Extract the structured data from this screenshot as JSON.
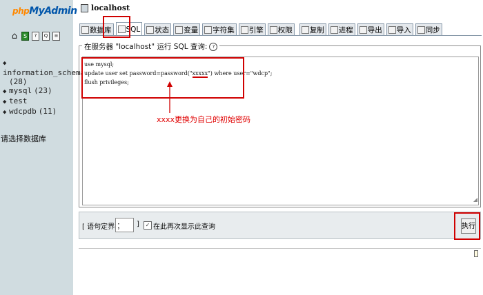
{
  "nav": {
    "logo_part1": "php",
    "logo_part2": "MyAdmin",
    "icons": [
      "home-icon",
      "sql-window-icon",
      "docs-icon",
      "query-window-icon",
      "settings-icon"
    ],
    "databases": [
      {
        "name": "information_schema",
        "count": "(28)"
      },
      {
        "name": "mysql",
        "count": "(23)"
      },
      {
        "name": "test",
        "count": ""
      },
      {
        "name": "wdcpdb",
        "count": "(11)"
      }
    ],
    "choose_db": "请选择数据库"
  },
  "header": {
    "server": "localhost"
  },
  "tabs": [
    {
      "label": "数据库",
      "icon": "database-icon"
    },
    {
      "label": "SQL",
      "icon": "sql-icon",
      "active": true
    },
    {
      "label": "状态",
      "icon": "status-icon"
    },
    {
      "label": "变量",
      "icon": "variables-icon"
    },
    {
      "label": "字符集",
      "icon": "charset-icon"
    },
    {
      "label": "引擎",
      "icon": "engine-icon"
    },
    {
      "label": "权限",
      "icon": "privileges-icon"
    },
    {
      "label": "复制",
      "icon": "replication-icon"
    },
    {
      "label": "进程",
      "icon": "process-icon"
    },
    {
      "label": "导出",
      "icon": "export-icon"
    },
    {
      "label": "导入",
      "icon": "import-icon"
    },
    {
      "label": "同步",
      "icon": "sync-icon"
    }
  ],
  "query": {
    "legend": "在服务器 \"localhost\" 运行 SQL 查询:",
    "lines": [
      "use mysql;",
      "update user set password=password(\"",
      "xxxxx",
      "\") where user=\"wdcp\";",
      "flush privileges;"
    ]
  },
  "annotation": {
    "text": "xxxx更换为自己的初始密码",
    "color": "#e00000"
  },
  "options": {
    "delimiter_label": "[ 语句定界符",
    "delimiter_value": ";",
    "delimiter_close": "]",
    "show_again_label": "在此再次显示此查询",
    "go_label": "执行"
  }
}
